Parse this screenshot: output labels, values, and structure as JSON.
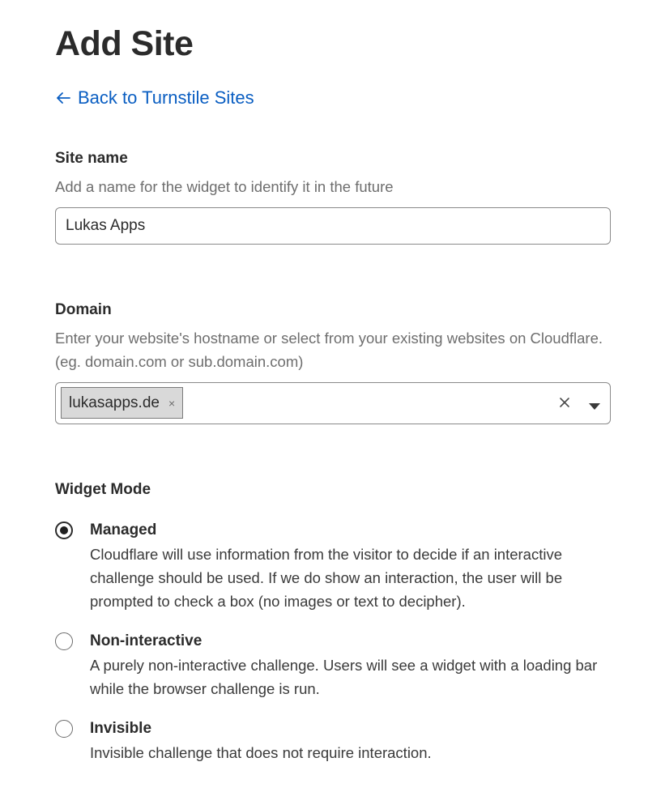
{
  "page": {
    "title": "Add Site",
    "back_link": "Back to Turnstile Sites"
  },
  "site_name": {
    "label": "Site name",
    "help": "Add a name for the widget to identify it in the future",
    "value": "Lukas Apps"
  },
  "domain": {
    "label": "Domain",
    "help": "Enter your website's hostname or select from your existing websites on Cloudflare. (eg. domain.com or sub.domain.com)",
    "selected": "lukasapps.de",
    "chip_remove": "×"
  },
  "widget_mode": {
    "label": "Widget Mode",
    "options": [
      {
        "title": "Managed",
        "description": "Cloudflare will use information from the visitor to decide if an interactive challenge should be used. If we do show an interaction, the user will be prompted to check a box (no images or text to decipher).",
        "selected": true
      },
      {
        "title": "Non-interactive",
        "description": "A purely non-interactive challenge. Users will see a widget with a loading bar while the browser challenge is run.",
        "selected": false
      },
      {
        "title": "Invisible",
        "description": "Invisible challenge that does not require interaction.",
        "selected": false
      }
    ]
  },
  "colors": {
    "link": "#0a5ec2",
    "text": "#2b2b2b",
    "muted": "#6e6e6e",
    "border": "#8a8a8a",
    "chip_bg": "#d9d9d9"
  },
  "icons": {
    "back": "arrow-left-icon",
    "clear": "close-icon",
    "dropdown": "caret-down-icon",
    "chip_remove": "close-icon"
  }
}
